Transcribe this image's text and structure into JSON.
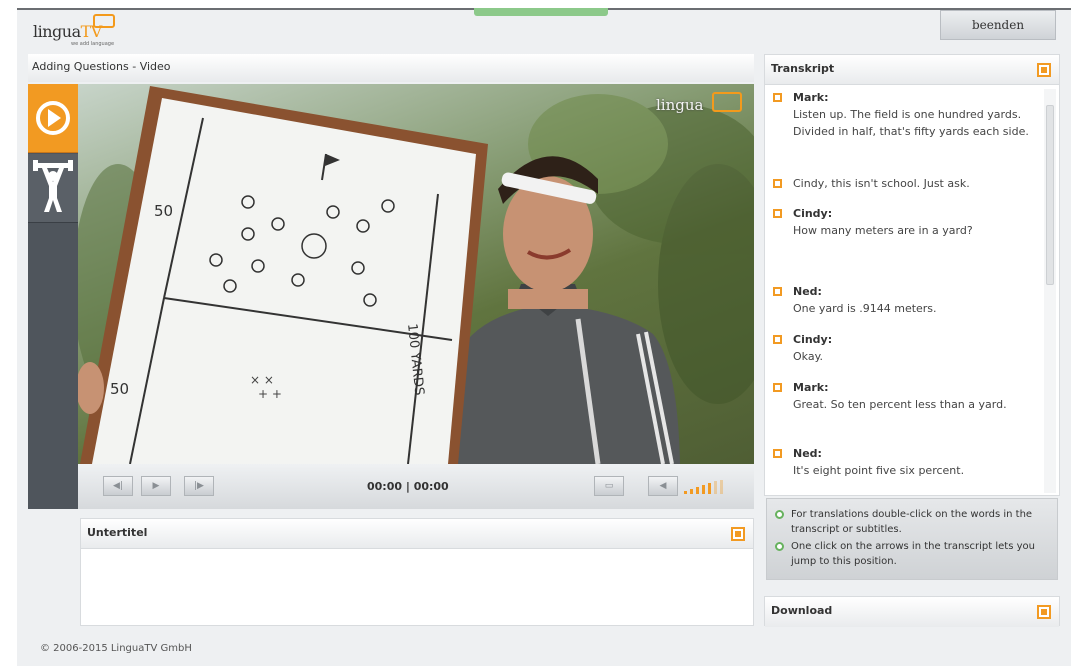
{
  "app": {
    "logo": {
      "word": "lingua",
      "tv": "TV",
      "tagline": "we add language"
    },
    "exit_button": "beenden",
    "copyright": "© 2006-2015 LinguaTV GmbH"
  },
  "left_panel": {
    "title": "Adding Questions - Video",
    "tabs": [
      {
        "icon": "play-circle-icon",
        "active": true
      },
      {
        "icon": "weightlifter-icon",
        "active": false
      }
    ]
  },
  "video": {
    "watermark": "lingua",
    "whiteboard": {
      "label_top": "50",
      "label_bottom": "50",
      "label_side": "100 YARDS"
    },
    "controls": {
      "prev": "◀|",
      "play": "▶",
      "next": "|▶",
      "time": "00:00 | 00:00",
      "volume_level": 0.8
    }
  },
  "subtitles_panel": {
    "title": "Untertitel"
  },
  "transcript": {
    "title": "Transkript",
    "entries": [
      {
        "speaker": "Mark:",
        "text": "Listen up. The field is one hundred yards. Divided in half, that's fifty yards each side."
      },
      {
        "speaker": "",
        "text": "Cindy, this isn't school. Just ask."
      },
      {
        "speaker": "Cindy:",
        "text": "How many meters are in a yard?"
      },
      {
        "speaker": "Ned:",
        "text": "One yard is .9144 meters."
      },
      {
        "speaker": "Cindy:",
        "text": "Okay."
      },
      {
        "speaker": "Mark:",
        "text": "Great. So ten percent less than a yard."
      },
      {
        "speaker": "Ned:",
        "text": "It's eight point five six percent."
      }
    ]
  },
  "tips": [
    "For translations double-click on the words in the transcript or subtitles.",
    "One click on the arrows in the transcript lets you jump to this position."
  ],
  "download": {
    "title": "Download"
  },
  "colors": {
    "accent": "#f29a22",
    "tip_green": "#67b25e",
    "sidebar": "#4f555c"
  }
}
